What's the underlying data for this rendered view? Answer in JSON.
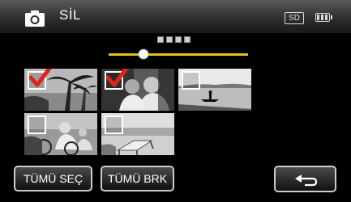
{
  "header": {
    "title": "SİL",
    "storage_label": "SD",
    "icons": [
      "camera-icon",
      "sd-card-icon",
      "battery-icon"
    ]
  },
  "page_indicator": {
    "icon": "page-dots-icon"
  },
  "slider": {
    "position": 0.25,
    "accent": "#e3c11b"
  },
  "thumbnails": [
    {
      "name": "palm-trees",
      "selected": true
    },
    {
      "name": "couple",
      "selected": true
    },
    {
      "name": "lake-boat",
      "selected": false
    },
    {
      "name": "family-bicycle",
      "selected": false
    },
    {
      "name": "beach-chair",
      "selected": false
    }
  ],
  "buttons": {
    "select_all": "TÜMÜ SEÇ",
    "deselect_all": "TÜMÜ BRK",
    "back_icon": "return-arrow-icon"
  },
  "colors": {
    "check_red": "#e0241b",
    "slider_yellow": "#e3c11b"
  }
}
